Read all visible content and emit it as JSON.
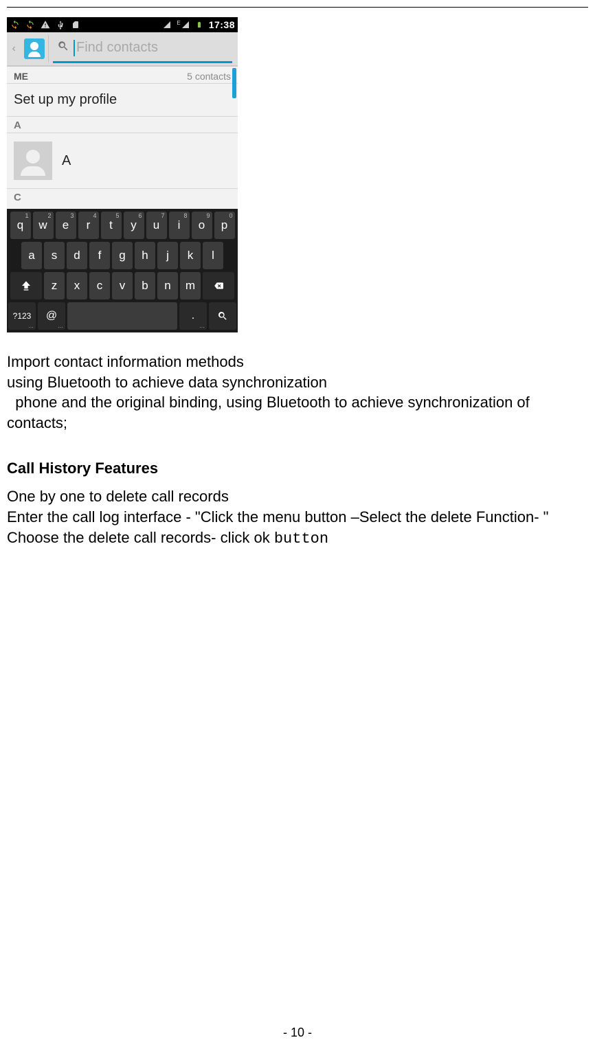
{
  "statusbar": {
    "time": "17:38",
    "net_label": "E"
  },
  "appbar": {
    "search_placeholder": "Find contacts"
  },
  "list": {
    "me_label": "ME",
    "count_text": "5 contacts",
    "profile_row": "Set up my profile",
    "section_a": "A",
    "contact_a_name": "A",
    "section_c": "C"
  },
  "keyboard": {
    "row1": [
      {
        "k": "q",
        "s": "1"
      },
      {
        "k": "w",
        "s": "2"
      },
      {
        "k": "e",
        "s": "3"
      },
      {
        "k": "r",
        "s": "4"
      },
      {
        "k": "t",
        "s": "5"
      },
      {
        "k": "y",
        "s": "6"
      },
      {
        "k": "u",
        "s": "7"
      },
      {
        "k": "i",
        "s": "8"
      },
      {
        "k": "o",
        "s": "9"
      },
      {
        "k": "p",
        "s": "0"
      }
    ],
    "row2": [
      "a",
      "s",
      "d",
      "f",
      "g",
      "h",
      "j",
      "k",
      "l"
    ],
    "row3": [
      "z",
      "x",
      "c",
      "v",
      "b",
      "n",
      "m"
    ],
    "sym": "?123",
    "at": "@",
    "dot": "."
  },
  "doc": {
    "p1": "Import contact information methods",
    "p2": "using Bluetooth to achieve data synchronization",
    "p3": "  phone and the original binding, using Bluetooth to achieve synchronization of contacts;",
    "h1": "Call History Features",
    "p4": "One by one to delete call records",
    "p5a": "Enter the call log interface - \"Click the menu button –Select the delete Function- \" Choose the delete call records- click ok ",
    "p5b": "button"
  },
  "footer": "- 10 -"
}
